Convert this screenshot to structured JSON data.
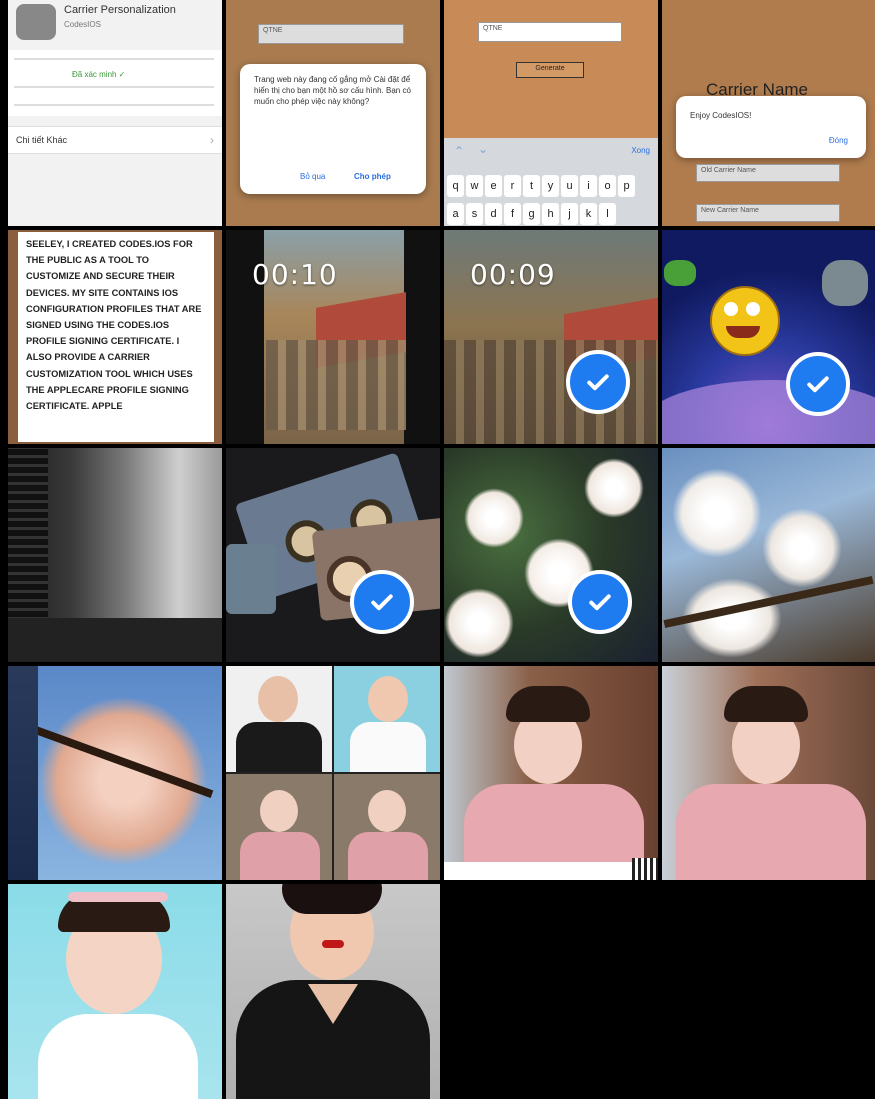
{
  "tiles": {
    "t1": {
      "row_label": "Chi tiết Khác",
      "carrier": "Carrier Personalization",
      "status": "Đã xác minh ✓",
      "sub1": "CodesIOS"
    },
    "t2": {
      "input_value": "QTNE",
      "dialog_text": "Trang web này đang cố gắng mở Cài đặt để hiển thị cho bạn một hồ sơ cấu hình. Bạn có muốn cho phép việc này không?",
      "ignore_label": "Bỏ qua",
      "allow_label": "Cho phép"
    },
    "t3": {
      "input_value": "QTNE",
      "generate_label": "Generate",
      "done_label": "Xong",
      "keys_row1": [
        "q",
        "w",
        "e",
        "r",
        "t",
        "y",
        "u",
        "i",
        "o",
        "p"
      ],
      "keys_row2": [
        "a",
        "s",
        "d",
        "f",
        "g",
        "h",
        "j",
        "k",
        "l"
      ]
    },
    "t4": {
      "title": "Carrier Name",
      "dialog_text": "Enjoy CodesIOS!",
      "ok_label": "Đóng",
      "field1": "Old Carrier Name",
      "field2": "New Carrier Name"
    },
    "t5": {
      "text": "SEELEY, I CREATED CODES.IOS FOR THE PUBLIC AS A TOOL TO CUSTOMIZE AND SECURE THEIR DEVICES. MY SITE CONTAINS IOS CONFIGURATION PROFILES THAT ARE SIGNED USING THE CODES.IOS PROFILE SIGNING CERTIFICATE. I ALSO PROVIDE A CARRIER CUSTOMIZATION TOOL WHICH USES THE APPLECARE PROFILE SIGNING CERTIFICATE. APPLE"
    },
    "t6": {
      "duration": "00:10"
    },
    "t7": {
      "duration": "00:09"
    }
  },
  "colors": {
    "accent": "#1e7bf0",
    "background": "#000000"
  }
}
